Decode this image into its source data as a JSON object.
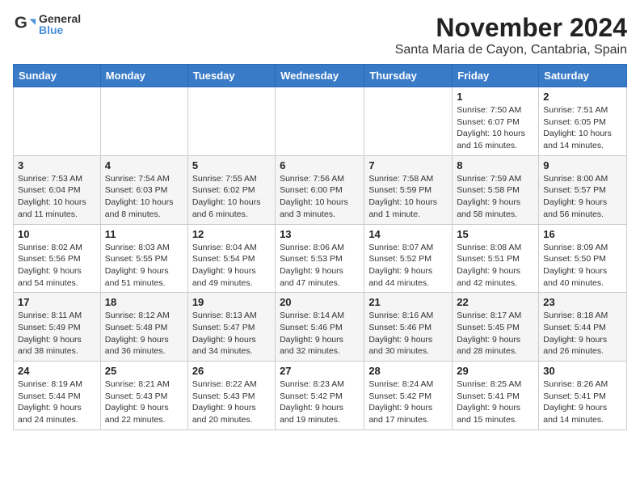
{
  "logo": {
    "general": "General",
    "blue": "Blue"
  },
  "title": "November 2024",
  "location": "Santa Maria de Cayon, Cantabria, Spain",
  "weekdays": [
    "Sunday",
    "Monday",
    "Tuesday",
    "Wednesday",
    "Thursday",
    "Friday",
    "Saturday"
  ],
  "weeks": [
    [
      {
        "day": "",
        "info": ""
      },
      {
        "day": "",
        "info": ""
      },
      {
        "day": "",
        "info": ""
      },
      {
        "day": "",
        "info": ""
      },
      {
        "day": "",
        "info": ""
      },
      {
        "day": "1",
        "info": "Sunrise: 7:50 AM\nSunset: 6:07 PM\nDaylight: 10 hours\nand 16 minutes."
      },
      {
        "day": "2",
        "info": "Sunrise: 7:51 AM\nSunset: 6:05 PM\nDaylight: 10 hours\nand 14 minutes."
      }
    ],
    [
      {
        "day": "3",
        "info": "Sunrise: 7:53 AM\nSunset: 6:04 PM\nDaylight: 10 hours\nand 11 minutes."
      },
      {
        "day": "4",
        "info": "Sunrise: 7:54 AM\nSunset: 6:03 PM\nDaylight: 10 hours\nand 8 minutes."
      },
      {
        "day": "5",
        "info": "Sunrise: 7:55 AM\nSunset: 6:02 PM\nDaylight: 10 hours\nand 6 minutes."
      },
      {
        "day": "6",
        "info": "Sunrise: 7:56 AM\nSunset: 6:00 PM\nDaylight: 10 hours\nand 3 minutes."
      },
      {
        "day": "7",
        "info": "Sunrise: 7:58 AM\nSunset: 5:59 PM\nDaylight: 10 hours\nand 1 minute."
      },
      {
        "day": "8",
        "info": "Sunrise: 7:59 AM\nSunset: 5:58 PM\nDaylight: 9 hours\nand 58 minutes."
      },
      {
        "day": "9",
        "info": "Sunrise: 8:00 AM\nSunset: 5:57 PM\nDaylight: 9 hours\nand 56 minutes."
      }
    ],
    [
      {
        "day": "10",
        "info": "Sunrise: 8:02 AM\nSunset: 5:56 PM\nDaylight: 9 hours\nand 54 minutes."
      },
      {
        "day": "11",
        "info": "Sunrise: 8:03 AM\nSunset: 5:55 PM\nDaylight: 9 hours\nand 51 minutes."
      },
      {
        "day": "12",
        "info": "Sunrise: 8:04 AM\nSunset: 5:54 PM\nDaylight: 9 hours\nand 49 minutes."
      },
      {
        "day": "13",
        "info": "Sunrise: 8:06 AM\nSunset: 5:53 PM\nDaylight: 9 hours\nand 47 minutes."
      },
      {
        "day": "14",
        "info": "Sunrise: 8:07 AM\nSunset: 5:52 PM\nDaylight: 9 hours\nand 44 minutes."
      },
      {
        "day": "15",
        "info": "Sunrise: 8:08 AM\nSunset: 5:51 PM\nDaylight: 9 hours\nand 42 minutes."
      },
      {
        "day": "16",
        "info": "Sunrise: 8:09 AM\nSunset: 5:50 PM\nDaylight: 9 hours\nand 40 minutes."
      }
    ],
    [
      {
        "day": "17",
        "info": "Sunrise: 8:11 AM\nSunset: 5:49 PM\nDaylight: 9 hours\nand 38 minutes."
      },
      {
        "day": "18",
        "info": "Sunrise: 8:12 AM\nSunset: 5:48 PM\nDaylight: 9 hours\nand 36 minutes."
      },
      {
        "day": "19",
        "info": "Sunrise: 8:13 AM\nSunset: 5:47 PM\nDaylight: 9 hours\nand 34 minutes."
      },
      {
        "day": "20",
        "info": "Sunrise: 8:14 AM\nSunset: 5:46 PM\nDaylight: 9 hours\nand 32 minutes."
      },
      {
        "day": "21",
        "info": "Sunrise: 8:16 AM\nSunset: 5:46 PM\nDaylight: 9 hours\nand 30 minutes."
      },
      {
        "day": "22",
        "info": "Sunrise: 8:17 AM\nSunset: 5:45 PM\nDaylight: 9 hours\nand 28 minutes."
      },
      {
        "day": "23",
        "info": "Sunrise: 8:18 AM\nSunset: 5:44 PM\nDaylight: 9 hours\nand 26 minutes."
      }
    ],
    [
      {
        "day": "24",
        "info": "Sunrise: 8:19 AM\nSunset: 5:44 PM\nDaylight: 9 hours\nand 24 minutes."
      },
      {
        "day": "25",
        "info": "Sunrise: 8:21 AM\nSunset: 5:43 PM\nDaylight: 9 hours\nand 22 minutes."
      },
      {
        "day": "26",
        "info": "Sunrise: 8:22 AM\nSunset: 5:43 PM\nDaylight: 9 hours\nand 20 minutes."
      },
      {
        "day": "27",
        "info": "Sunrise: 8:23 AM\nSunset: 5:42 PM\nDaylight: 9 hours\nand 19 minutes."
      },
      {
        "day": "28",
        "info": "Sunrise: 8:24 AM\nSunset: 5:42 PM\nDaylight: 9 hours\nand 17 minutes."
      },
      {
        "day": "29",
        "info": "Sunrise: 8:25 AM\nSunset: 5:41 PM\nDaylight: 9 hours\nand 15 minutes."
      },
      {
        "day": "30",
        "info": "Sunrise: 8:26 AM\nSunset: 5:41 PM\nDaylight: 9 hours\nand 14 minutes."
      }
    ]
  ]
}
